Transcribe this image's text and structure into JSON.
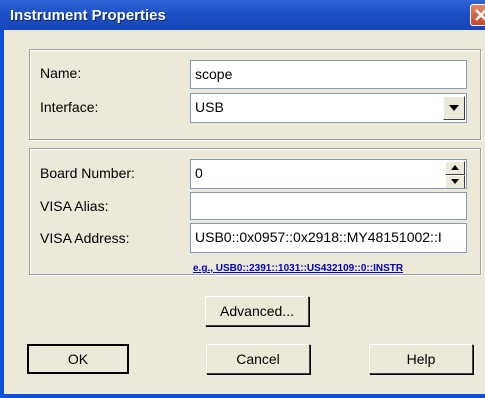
{
  "window": {
    "title": "Instrument Properties",
    "close_icon": "close-icon"
  },
  "basic": {
    "name_label": "Name:",
    "name_value": "scope",
    "interface_label": "Interface:",
    "interface_value": "USB"
  },
  "visa": {
    "board_number_label": "Board Number:",
    "board_number_value": "0",
    "visa_alias_label": "VISA Alias:",
    "visa_alias_value": "",
    "visa_address_label": "VISA Address:",
    "visa_address_value": "USB0::0x0957::0x2918::MY48151002::I",
    "example_text": "e.g., USB0::2391::1031::US432109::0::INSTR"
  },
  "buttons": {
    "advanced": "Advanced...",
    "ok": "OK",
    "cancel": "Cancel",
    "help": "Help"
  },
  "colors": {
    "title_bar": "#1d50c6",
    "dialog_bg": "#ece9d8",
    "link": "#0000cc"
  }
}
